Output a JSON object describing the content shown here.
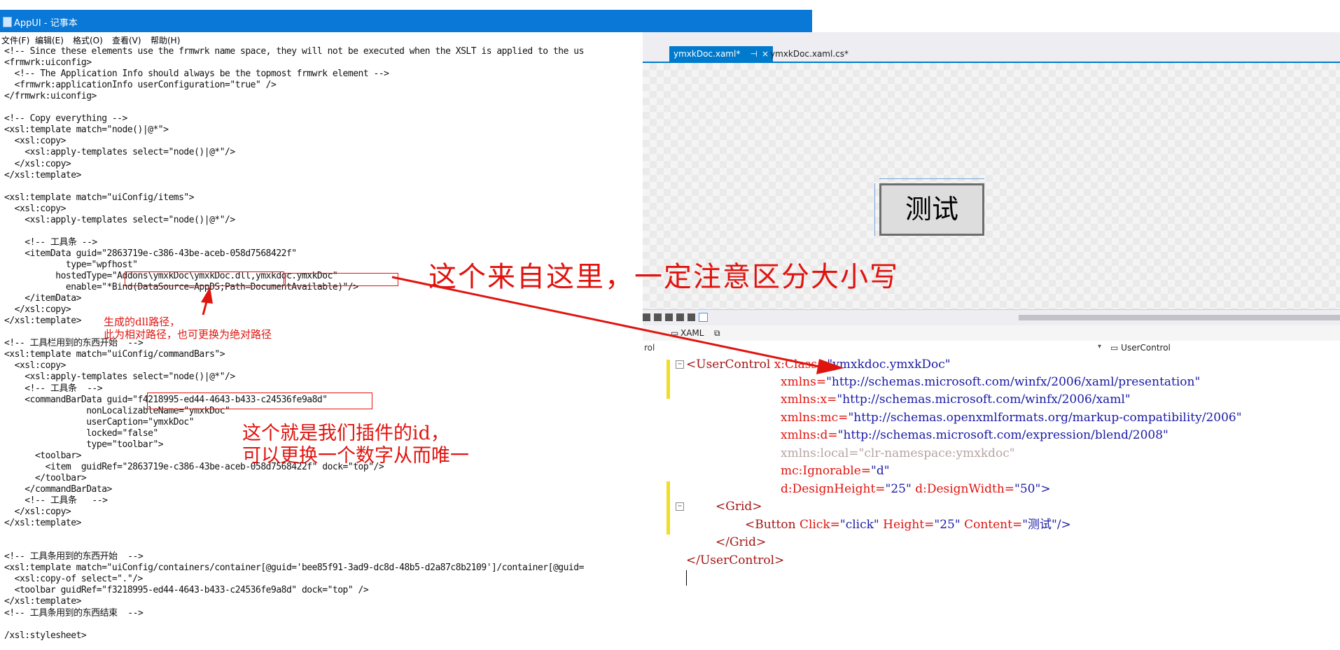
{
  "notepad": {
    "title": "AppUI - 记事本",
    "menu": [
      "文件(F)",
      "编辑(E)",
      "格式(O)",
      "查看(V)",
      "帮助(H)"
    ],
    "lines": [
      "<!-- Since these elements use the frmwrk name space, they will not be executed when the XSLT is applied to the us",
      "<frmwrk:uiconfig>",
      "  <!-- The Application Info should always be the topmost frmwrk element -->",
      "  <frmwrk:applicationInfo userConfiguration=\"true\" />",
      "</frmwrk:uiconfig>",
      "",
      "<!-- Copy everything -->",
      "<xsl:template match=\"node()|@*\">",
      "  <xsl:copy>",
      "    <xsl:apply-templates select=\"node()|@*\"/>",
      "  </xsl:copy>",
      "</xsl:template>",
      "",
      "<xsl:template match=\"uiConfig/items\">",
      "  <xsl:copy>",
      "    <xsl:apply-templates select=\"node()|@*\"/>",
      "",
      "    <!-- 工具条 -->",
      "    <itemData guid=\"2863719e-c386-43be-aceb-058d7568422f\"",
      "            type=\"wpfhost\"",
      "          hostedType=\"Addons\\ymxkDoc\\ymxkDoc.dll,ymxkdoc.ymxkDoc\"",
      "            enable=\"*Bind(DataSource=AppDS;Path=DocumentAvailable)\"/>",
      "    </itemData>",
      "  </xsl:copy>",
      "</xsl:template>",
      "",
      "<!-- 工具栏用到的东西开始  -->",
      "<xsl:template match=\"uiConfig/commandBars\">",
      "  <xsl:copy>",
      "    <xsl:apply-templates select=\"node()|@*\"/>",
      "    <!-- 工具条  -->",
      "    <commandBarData guid=\"f4218995-ed44-4643-b433-c24536fe9a8d\"",
      "                nonLocalizableName=\"ymxkDoc\"",
      "                userCaption=\"ymxkDoc\"",
      "                locked=\"false\"",
      "                type=\"toolbar\">",
      "      <toolbar>",
      "        <item  guidRef=\"2863719e-c386-43be-aceb-058d7568422f\" dock=\"top\"/>",
      "      </toolbar>",
      "    </commandBarData>",
      "    <!-- 工具条   -->",
      "  </xsl:copy>",
      "</xsl:template>",
      "",
      "",
      "<!-- 工具条用到的东西开始  -->",
      "<xsl:template match=\"uiConfig/containers/container[@guid='bee85f91-3ad9-dc8d-48b5-d2a87c8b2109']/container[@guid=",
      "  <xsl:copy-of select=\".\"/>",
      "  <toolbar guidRef=\"f3218995-ed44-4643-b433-c24536fe9a8d\" dock=\"top\" />",
      "</xsl:template>",
      "<!-- 工具条用到的东西结束  -->",
      "",
      "/xsl:stylesheet>"
    ]
  },
  "vs": {
    "tab_active": "ymxkDoc.xaml*",
    "tab_pin": "⊣",
    "tab_close": "×",
    "tab_2": "ymxkDoc.xaml.cs*",
    "design_button_text": "测试",
    "panel_tab_xaml": "XAML",
    "nav_left": "rol",
    "nav_right": "UserControl",
    "code": {
      "l1_tag": "<UserControl ",
      "l1_attr": "x:Class=",
      "l1_val": "\"ymxkdoc.ymxkDoc\"",
      "l2_attr": "xmlns=",
      "l2_val": "\"http://schemas.microsoft.com/winfx/2006/xaml/presentation\"",
      "l3_attr": "xmlns:x=",
      "l3_val": "\"http://schemas.microsoft.com/winfx/2006/xaml\"",
      "l4_attr": "xmlns:mc=",
      "l4_val": "\"http://schemas.openxmlformats.org/markup-compatibility/2006\"",
      "l5_attr": "xmlns:d=",
      "l5_val": "\"http://schemas.microsoft.com/expression/blend/2008\"",
      "l6": "xmlns:local=\"clr-namespace:ymxkdoc\"",
      "l7_attr": "mc:Ignorable=",
      "l7_val": "\"d\"",
      "l8_attr1": "d:DesignHeight=",
      "l8_val1": "\"25\"",
      "l8_attr2": " d:DesignWidth=",
      "l8_val2": "\"50\"",
      "l8_end": ">",
      "l9": "<Grid>",
      "l10_tag": "<Button ",
      "l10_a1": "Click=",
      "l10_v1": "\"click\"",
      "l10_a2": " Height=",
      "l10_v2": "\"25\"",
      "l10_a3": " Content=",
      "l10_v3": "\"测试\"",
      "l10_end": "/>",
      "l11": "</Grid>",
      "l12": "</UserControl>"
    }
  },
  "annotations": {
    "big": "这个来自这里，一定注意区分大小写",
    "dll_1": "生成的dll路径，",
    "dll_2": "此为相对路径，也可更换为绝对路径",
    "id_1": "这个就是我们插件的id，",
    "id_2": "可以更换一个数字从而唯一"
  }
}
